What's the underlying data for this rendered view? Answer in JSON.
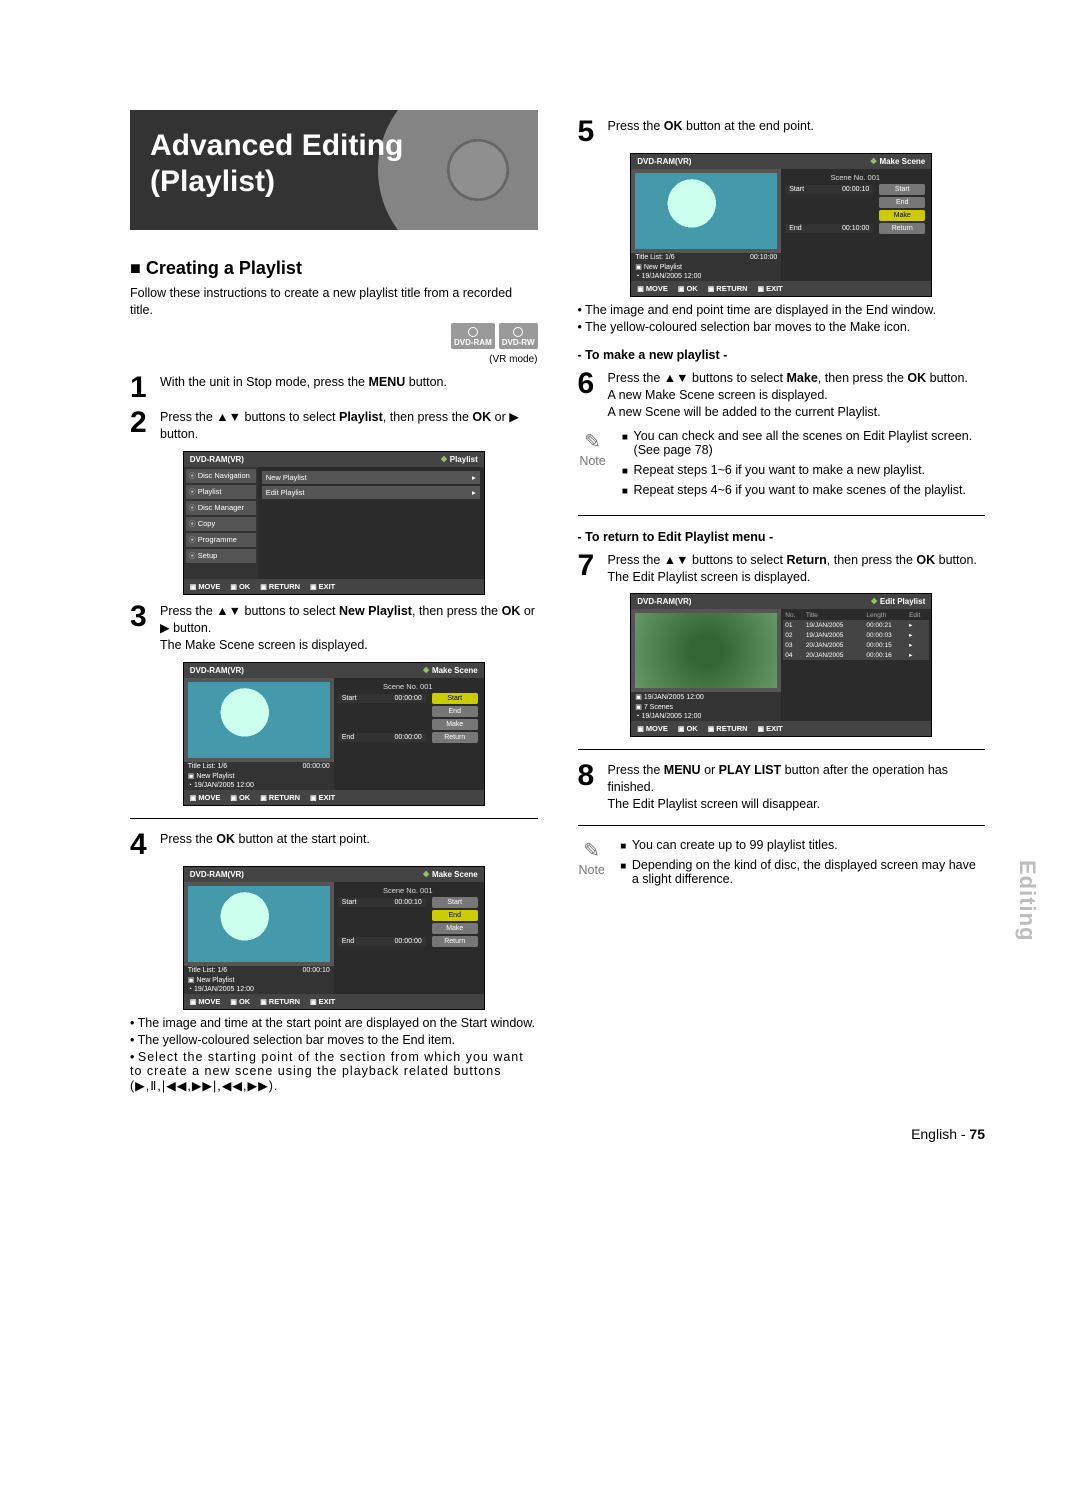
{
  "header": {
    "title": "Advanced Editing (Playlist)"
  },
  "section_title": "Creating a Playlist",
  "intro": "Follow these instructions to create a new playlist title from a recorded title.",
  "disc_tags": [
    "DVD-RAM",
    "DVD-RW"
  ],
  "vr_mode_note": "(VR mode)",
  "steps": {
    "s1": {
      "num": "1",
      "text_a": "With the unit in Stop mode, press the ",
      "bold_a": "MENU",
      "text_b": " button."
    },
    "s2": {
      "num": "2",
      "text_a": "Press the ▲▼ buttons to select ",
      "bold_a": "Playlist",
      "text_b": ", then press the ",
      "bold_b": "OK",
      "text_c": " or ▶ button."
    },
    "s3": {
      "num": "3",
      "text_a": "Press the ▲▼ buttons to select ",
      "bold_a": "New Playlist",
      "text_b": ", then press the ",
      "bold_b": "OK",
      "text_c": " or ▶ button.",
      "tail": "The Make Scene screen is displayed."
    },
    "s4": {
      "num": "4",
      "text_a": "Press the ",
      "bold_a": "OK",
      "text_b": " button at the start point."
    },
    "s5": {
      "num": "5",
      "text_a": "Press the ",
      "bold_a": "OK",
      "text_b": " button at the end point."
    },
    "s6": {
      "num": "6",
      "text_a": "Press the ▲▼ buttons to select ",
      "bold_a": "Make",
      "text_b": ", then press the ",
      "bold_b": "OK",
      "text_c": " button.",
      "tail1": "A new Make Scene screen is displayed.",
      "tail2": "A new Scene will be added to the current Playlist."
    },
    "s7": {
      "num": "7",
      "text_a": "Press the ▲▼ buttons to select ",
      "bold_a": "Return",
      "text_b": ", then press the ",
      "bold_b": "OK",
      "text_c": " button.",
      "tail": "The Edit Playlist screen is displayed."
    },
    "s8": {
      "num": "8",
      "text_a": "Press the ",
      "bold_a": "MENU",
      "text_b": " or ",
      "bold_b": "PLAY LIST",
      "text_c": " button after the operation has finished.",
      "tail": "The Edit Playlist screen will disappear."
    }
  },
  "osd_common": {
    "device": "DVD-RAM(VR)",
    "crumb_playlist": "Playlist",
    "crumb_makescene": "Make Scene",
    "crumb_editplaylist": "Edit Playlist",
    "footer": [
      "MOVE",
      "OK",
      "RETURN",
      "EXIT"
    ]
  },
  "osd_menu": {
    "side_items": [
      "Disc Navigation",
      "Playlist",
      "Disc Manager",
      "Copy",
      "Programme",
      "Setup"
    ],
    "sub_items": [
      "New Playlist",
      "Edit Playlist"
    ]
  },
  "osd_scene": {
    "buttons": [
      "Start",
      "End",
      "Make",
      "Return"
    ],
    "scene_no": "Scene No. 001",
    "title_list": "Title List: 1/6",
    "np": "New Playlist",
    "date": "19/JAN/2005 12:00",
    "screen3": {
      "hl": "Start",
      "start_t": "00:00:00",
      "end_t": "00:00:00",
      "tl_time": "00:00:00"
    },
    "screen4": {
      "hl": "End",
      "start_t": "00:00:10",
      "end_t": "00:00:00",
      "tl_time": "00:00:10"
    },
    "screen5": {
      "hl": "Make",
      "start_t": "00:00:10",
      "end_t": "00:10:00",
      "tl_time": "00:10:00"
    }
  },
  "osd_edit": {
    "columns": [
      "No.",
      "Title",
      "Length",
      "Edit"
    ],
    "rows": [
      {
        "no": "01",
        "title": "19/JAN/2005",
        "len": "00:00:21"
      },
      {
        "no": "02",
        "title": "19/JAN/2005",
        "len": "00:00:03"
      },
      {
        "no": "03",
        "title": "20/JAN/2005",
        "len": "00:00:15"
      },
      {
        "no": "04",
        "title": "20/JAN/2005",
        "len": "00:00:16"
      }
    ],
    "info1": "19/JAN/2005 12:00",
    "info2": "7 Scenes",
    "info3": "19/JAN/2005 12:00"
  },
  "after_step4_bullets": [
    "The image and time at the start point are displayed on the Start window.",
    "The yellow-coloured selection bar moves to the End item.",
    "Select the starting point of the section from which you want to create a new scene using the playback related buttons (▶,Ⅱ,|◀◀,▶▶|,◀◀,▶▶)."
  ],
  "after_step5_bullets": [
    "The image and end point time are displayed in the End window.",
    "The yellow-coloured selection bar moves to the Make icon."
  ],
  "subhead_make": "- To make a new playlist -",
  "note1_label": "Note",
  "note1_items": [
    "You can check and see all the scenes on Edit Playlist screen. (See page 78)",
    "Repeat steps 1~6 if you want to make a new playlist.",
    "Repeat steps 4~6 if you want to make scenes of the playlist."
  ],
  "subhead_return": "- To return to Edit Playlist menu -",
  "note2_label": "Note",
  "note2_items": [
    "You can create up to 99 playlist titles.",
    "Depending on the kind of disc, the displayed screen may have a slight difference."
  ],
  "side_tab": "Editing",
  "footer": {
    "lang": "English - ",
    "page": "75"
  }
}
